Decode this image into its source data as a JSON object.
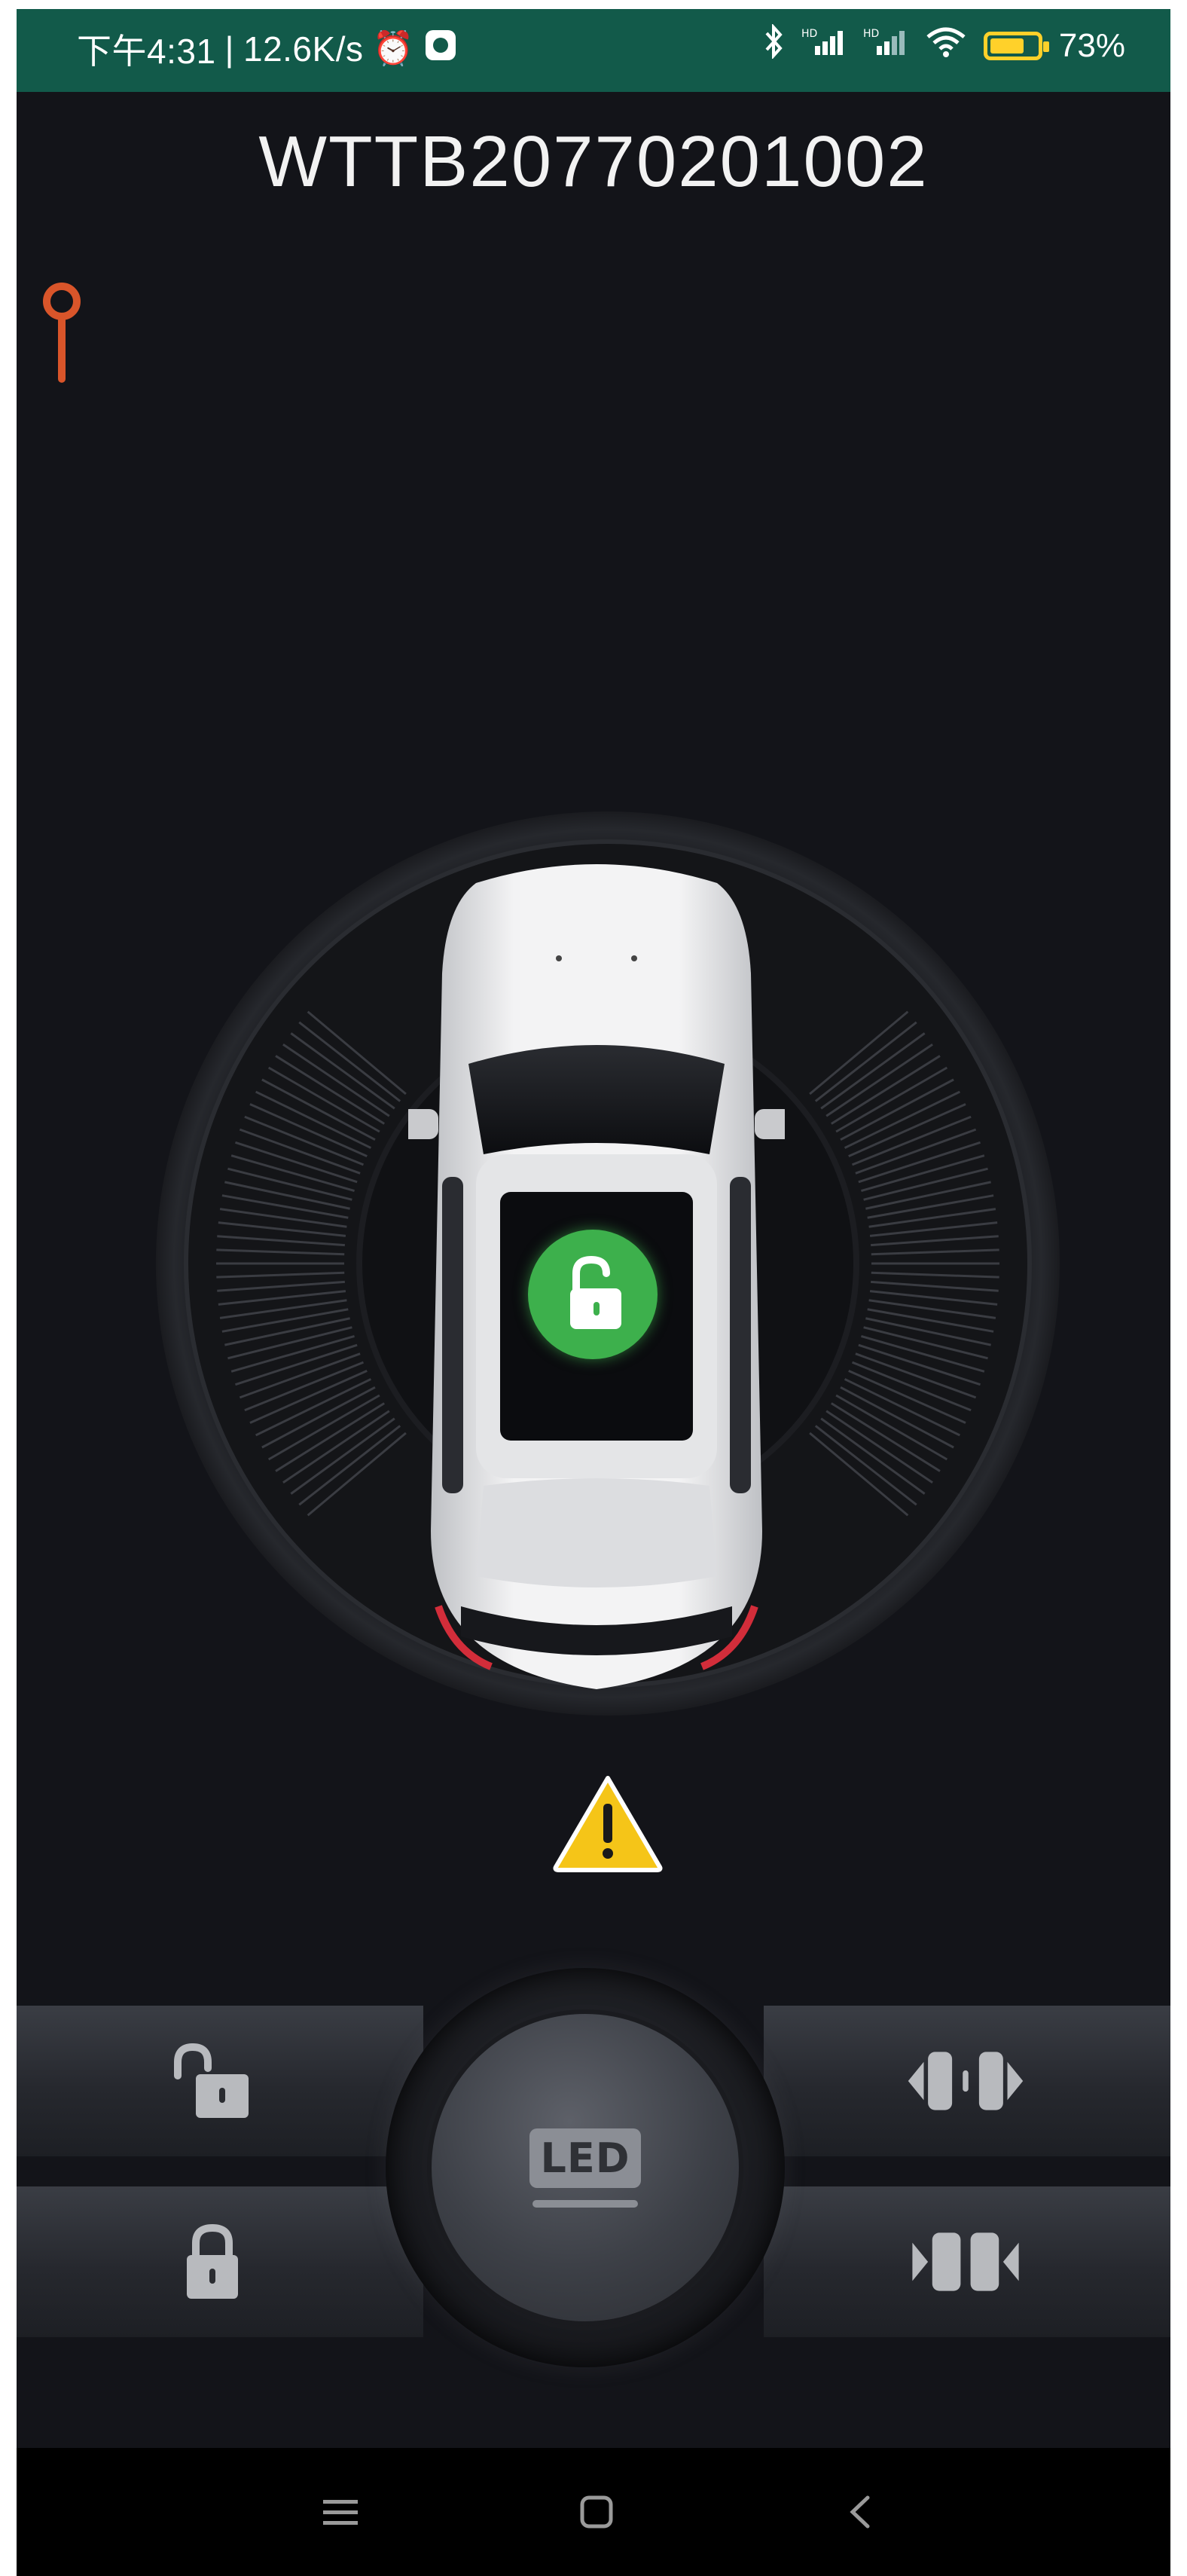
{
  "status_bar": {
    "time": "下午4:31",
    "net_speed": "12.6K/s",
    "battery_level": 0.73,
    "battery_percent": "73%",
    "icons": [
      "alarm-clock-icon",
      "app-notification-icon",
      "bluetooth-icon",
      "signal-hd-icon",
      "signal-hd-icon",
      "wifi-icon",
      "battery-icon"
    ]
  },
  "header": {
    "title": "WTTB20770201002"
  },
  "vehicle": {
    "lock_state": "unlocked",
    "status_color": "#3db04c"
  },
  "warning": {
    "icon": "warning-icon",
    "color": "#f5c518"
  },
  "controls": {
    "led_label": "LED",
    "left_top": "unlock-icon",
    "left_bottom": "lock-icon",
    "right_top": "open-door-icon",
    "right_bottom": "close-door-icon"
  },
  "colors": {
    "statusbar": "#125a4a",
    "background": "#131419",
    "pin": "#d9552a"
  },
  "nav": {
    "items": [
      "menu-icon",
      "home-icon",
      "back-icon"
    ]
  }
}
